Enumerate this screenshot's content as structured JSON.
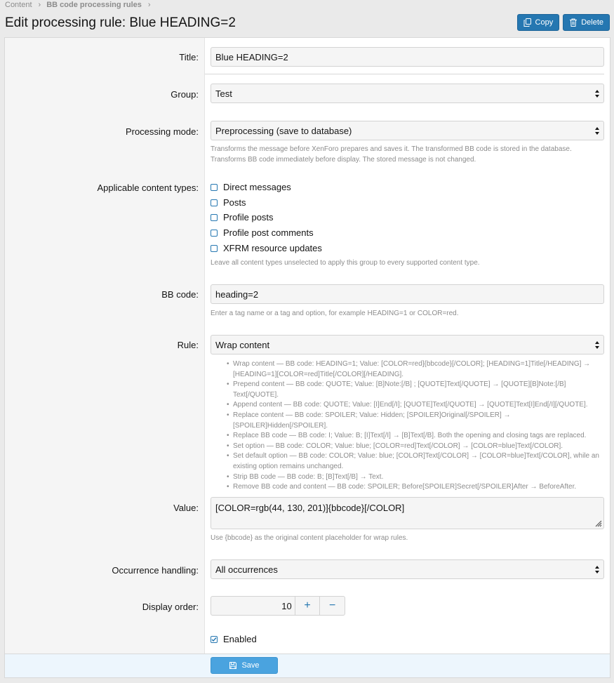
{
  "breadcrumbs": [
    {
      "label": "Content"
    },
    {
      "label": "BB code processing rules"
    }
  ],
  "page_title": "Edit processing rule: Blue HEADING=2",
  "actions": {
    "copy_label": "Copy",
    "delete_label": "Delete"
  },
  "form": {
    "title": {
      "label": "Title:",
      "value": "Blue HEADING=2"
    },
    "group": {
      "label": "Group:",
      "value": "Test"
    },
    "processing_mode": {
      "label": "Processing mode:",
      "value": "Preprocessing (save to database)",
      "hint_1": "Transforms the message before XenForo prepares and saves it. The transformed BB code is stored in the database.",
      "hint_2": "Transforms BB code immediately before display. The stored message is not changed."
    },
    "content_types": {
      "label": "Applicable content types:",
      "options": [
        {
          "label": "Direct messages",
          "checked": false
        },
        {
          "label": "Posts",
          "checked": false
        },
        {
          "label": "Profile posts",
          "checked": false
        },
        {
          "label": "Profile post comments",
          "checked": false
        },
        {
          "label": "XFRM resource updates",
          "checked": false
        }
      ],
      "hint": "Leave all content types unselected to apply this group to every supported content type."
    },
    "bb_code": {
      "label": "BB code:",
      "value": "heading=2",
      "hint": "Enter a tag name or a tag and option, for example HEADING=1 or COLOR=red."
    },
    "rule": {
      "label": "Rule:",
      "value": "Wrap content",
      "descriptions": [
        "Wrap content — BB code: HEADING=1; Value: [COLOR=red]{bbcode}[/COLOR]; [HEADING=1]Title[/HEADING] → [HEADING=1][COLOR=red]Title[/COLOR][/HEADING].",
        "Prepend content — BB code: QUOTE; Value: [B]Note:[/B] ; [QUOTE]Text[/QUOTE] → [QUOTE][B]Note:[/B] Text[/QUOTE].",
        "Append content — BB code: QUOTE; Value: [I]End[/I]; [QUOTE]Text[/QUOTE] → [QUOTE]Text[I]End[/I][/QUOTE].",
        "Replace content — BB code: SPOILER; Value: Hidden; [SPOILER]Original[/SPOILER] → [SPOILER]Hidden[/SPOILER].",
        "Replace BB code — BB code: I; Value: B; [I]Text[/I] → [B]Text[/B]. Both the opening and closing tags are replaced.",
        "Set option — BB code: COLOR; Value: blue; [COLOR=red]Text[/COLOR] → [COLOR=blue]Text[/COLOR].",
        "Set default option — BB code: COLOR; Value: blue; [COLOR]Text[/COLOR] → [COLOR=blue]Text[/COLOR], while an existing option remains unchanged.",
        "Strip BB code — BB code: B; [B]Text[/B] → Text.",
        "Remove BB code and content — BB code: SPOILER; Before[SPOILER]Secret[/SPOILER]After → BeforeAfter."
      ]
    },
    "value": {
      "label": "Value:",
      "value": "[COLOR=rgb(44, 130, 201)]{bbcode}[/COLOR]",
      "hint": "Use {bbcode} as the original content placeholder for wrap rules."
    },
    "occurrence": {
      "label": "Occurrence handling:",
      "value": "All occurrences"
    },
    "display_order": {
      "label": "Display order:",
      "value": "10",
      "plus": "+",
      "minus": "−"
    },
    "enabled": {
      "label": "Enabled",
      "checked": true
    }
  },
  "save_label": "Save",
  "colors": {
    "accent": "#2577b1",
    "save": "#4aa3df",
    "footer": "#edf6fd"
  }
}
